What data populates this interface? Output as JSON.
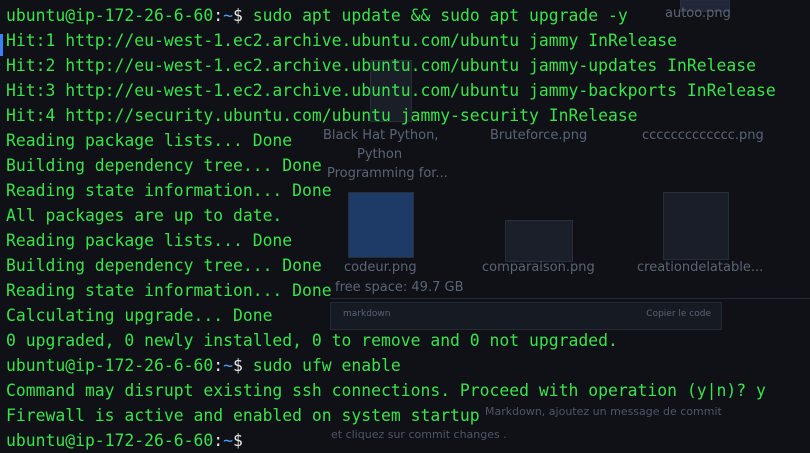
{
  "desktop": {
    "captions": [
      {
        "text": "autoo.png"
      },
      {
        "text": "Black Hat Python,"
      },
      {
        "text": "Python"
      },
      {
        "text": "Programming for..."
      },
      {
        "text": "Bruteforce.png"
      },
      {
        "text": "ccccccccccccc.png"
      },
      {
        "text": "codeur.png"
      },
      {
        "text": "comparaison.png"
      },
      {
        "text": "creationdelatable..."
      },
      {
        "text": "free space: 49.7 GB"
      }
    ],
    "panel_left": "markdown",
    "panel_right": "Copier le code",
    "note_1": "Markdown, ajoutez un message de commit",
    "note_2": "et cliquez sur  commit changes ."
  },
  "terminal": {
    "prompt": {
      "user_host": "ubuntu@ip-172-26-6-60",
      "colon": ":",
      "path": "~",
      "dollar": "$"
    },
    "lines": [
      {
        "type": "prompt",
        "command": " sudo apt update && sudo apt upgrade -y"
      },
      {
        "type": "output",
        "text": "Hit:1 http://eu-west-1.ec2.archive.ubuntu.com/ubuntu jammy InRelease"
      },
      {
        "type": "output",
        "text": "Hit:2 http://eu-west-1.ec2.archive.ubuntu.com/ubuntu jammy-updates InRelease"
      },
      {
        "type": "output",
        "text": "Hit:3 http://eu-west-1.ec2.archive.ubuntu.com/ubuntu jammy-backports InRelease"
      },
      {
        "type": "output",
        "text": "Hit:4 http://security.ubuntu.com/ubuntu jammy-security InRelease"
      },
      {
        "type": "output",
        "text": "Reading package lists... Done"
      },
      {
        "type": "output",
        "text": "Building dependency tree... Done"
      },
      {
        "type": "output",
        "text": "Reading state information... Done"
      },
      {
        "type": "output",
        "text": "All packages are up to date."
      },
      {
        "type": "output",
        "text": "Reading package lists... Done"
      },
      {
        "type": "output",
        "text": "Building dependency tree... Done"
      },
      {
        "type": "output",
        "text": "Reading state information... Done"
      },
      {
        "type": "output",
        "text": "Calculating upgrade... Done"
      },
      {
        "type": "output",
        "text": "0 upgraded, 0 newly installed, 0 to remove and 0 not upgraded."
      },
      {
        "type": "prompt",
        "command": " sudo ufw enable"
      },
      {
        "type": "output",
        "text": "Command may disrupt existing ssh connections. Proceed with operation (y|n)? y"
      },
      {
        "type": "output",
        "text": "Firewall is active and enabled on system startup"
      },
      {
        "type": "prompt",
        "command": ""
      }
    ]
  },
  "colors": {
    "background": "#0f1117",
    "output_green": "#39e34a",
    "path_blue": "#4aa3ff",
    "punct_white": "#e8e8e8",
    "focus_accent": "#3b82f6"
  }
}
